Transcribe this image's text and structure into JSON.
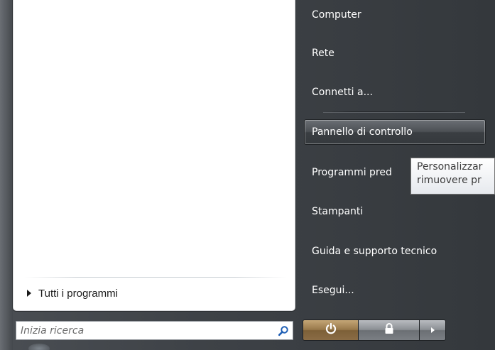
{
  "start_menu": {
    "search": {
      "placeholder": "Inizia ricerca"
    },
    "all_programs": {
      "label": "Tutti i programmi"
    },
    "right_items": [
      {
        "label": "Computer"
      },
      {
        "label": "Rete"
      },
      {
        "label": "Connetti a..."
      },
      {
        "label": "Pannello di controllo",
        "highlighted": true
      },
      {
        "label": "Programmi pred"
      },
      {
        "label": "Stampanti"
      },
      {
        "label": "Guida e supporto tecnico"
      },
      {
        "label": "Esegui..."
      }
    ],
    "tooltip": {
      "line1": "Personalizzar",
      "line2": "rimuovere pr"
    },
    "power_buttons": [
      {
        "icon": "power-icon"
      },
      {
        "icon": "lock-icon"
      },
      {
        "icon": "arrow-right-icon"
      }
    ]
  },
  "colors": {
    "menu_background": "#3e4247",
    "left_pane": "#ffffff",
    "power_button": "#98784a",
    "text_light": "#ffffff"
  }
}
